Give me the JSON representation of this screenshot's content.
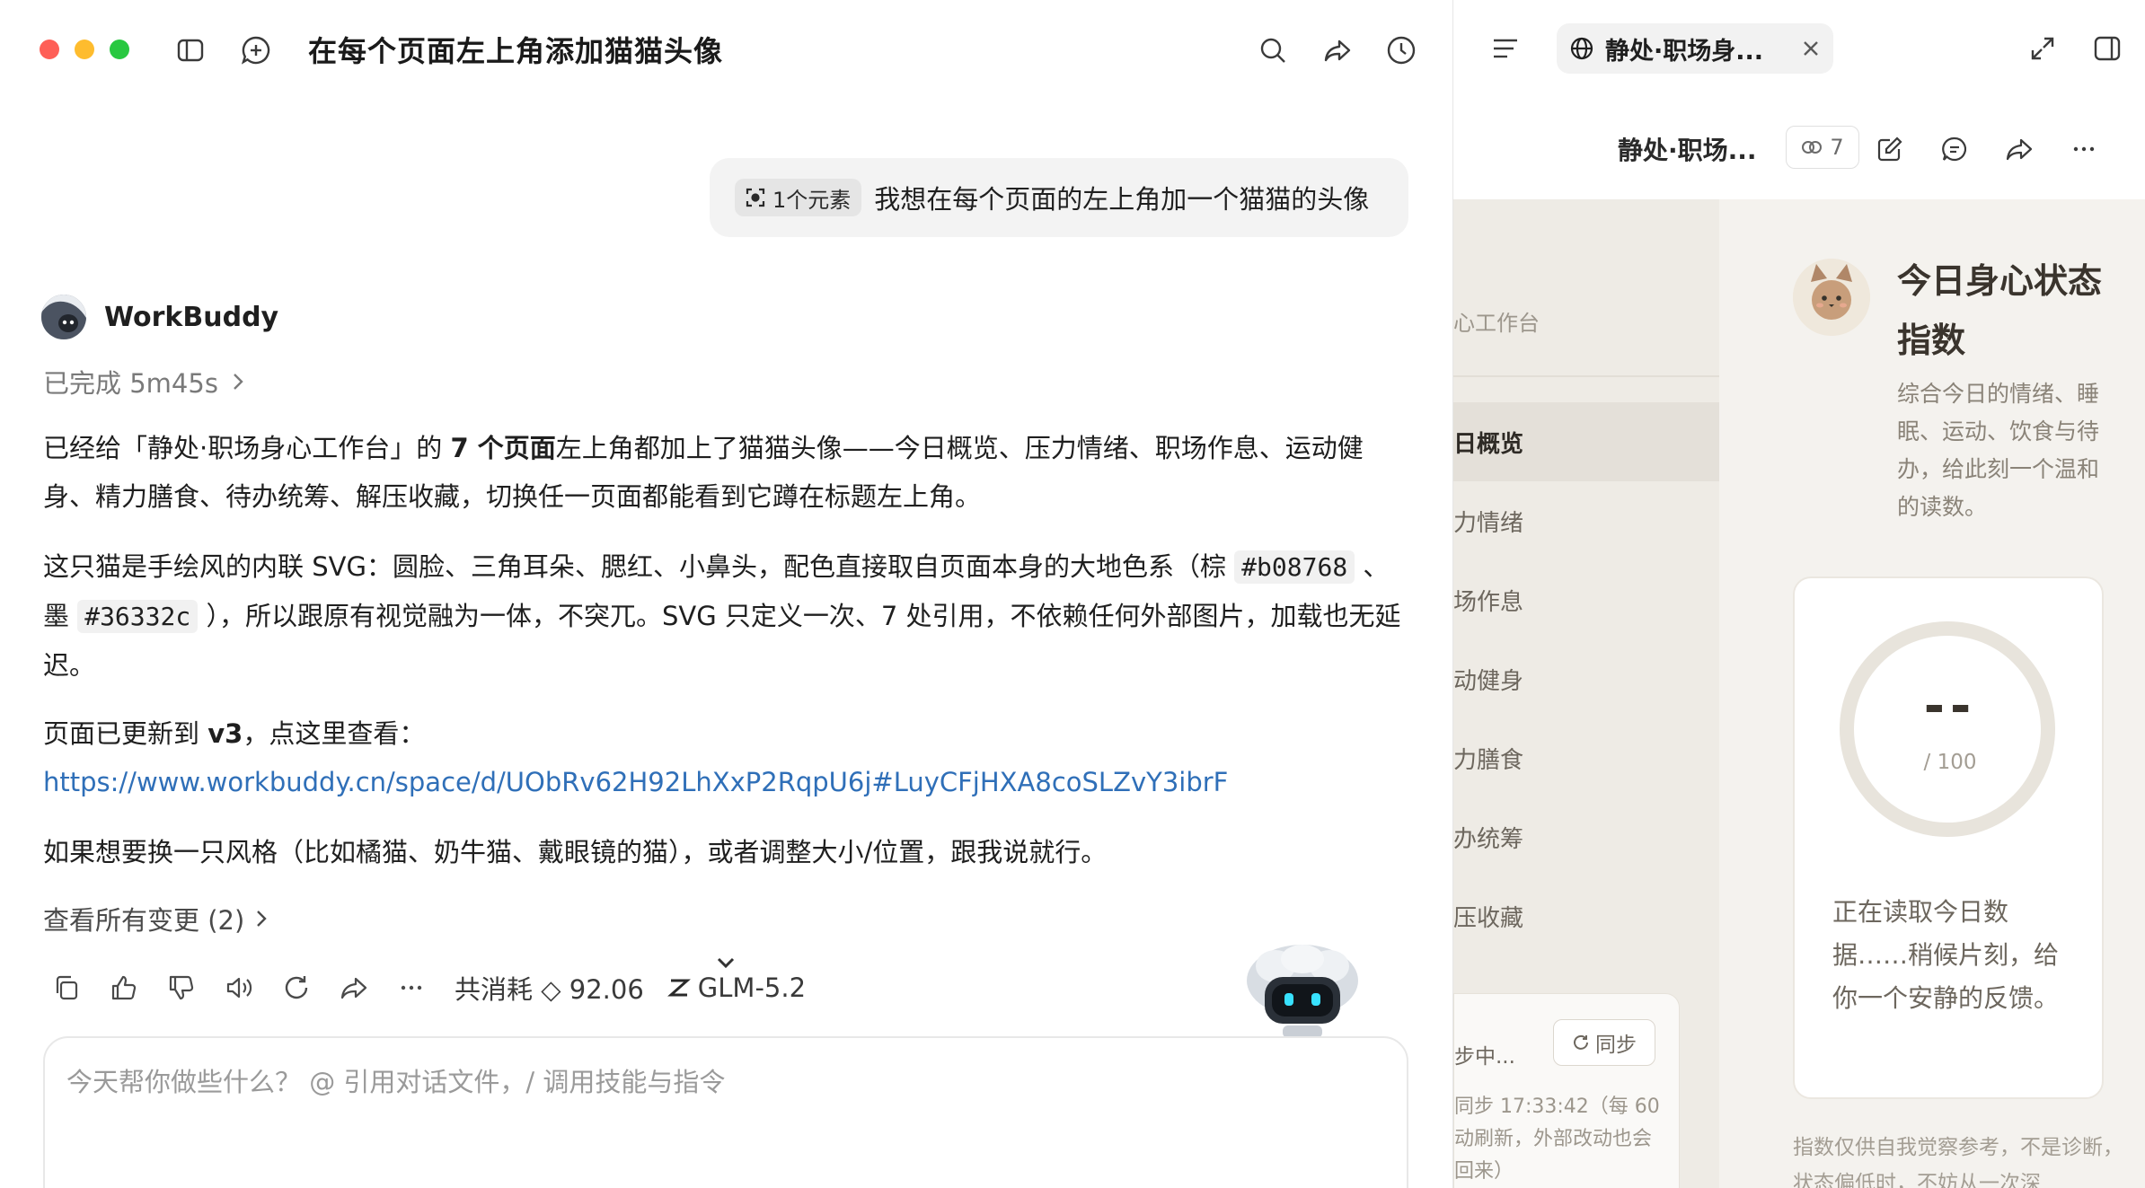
{
  "window": {
    "traffic_lights": {
      "close": "#fe5f57",
      "minimize": "#febc2e",
      "maximize": "#28c840"
    }
  },
  "chat": {
    "title": "在每个页面左上角添加猫猫头像",
    "user_message": {
      "chip_label": "1个元素",
      "text": "我想在每个页面的左上角加一个猫猫的头像"
    },
    "agent": {
      "name": "WorkBuddy",
      "status": "已完成 5m45s"
    },
    "response": {
      "p1_a": "已经给「静处·职场身心工作台」的 ",
      "p1_b": "7 个页面",
      "p1_c": "左上角都加上了猫猫头像——今日概览、压力情绪、职场作息、运动健身、精力膳食、待办统筹、解压收藏，切换任一页面都能看到它蹲在标题左上角。",
      "p2_a": "这只猫是手绘风的内联 SVG：圆脸、三角耳朵、腮红、小鼻头，配色直接取自页面本身的大地色系（棕 ",
      "p2_code1": "#b08768",
      "p2_b": " 、墨 ",
      "p2_code2": "#36332c",
      "p2_c": " ），所以跟原有视觉融为一体，不突兀。SVG 只定义一次、7 处引用，不依赖任何外部图片，加载也无延迟。",
      "p3_a": "页面已更新到 ",
      "p3_b": "v3",
      "p3_c": "，点这里查看：",
      "link": "https://www.workbuddy.cn/space/d/UObRv62H92LhXxP2RqpU6j#LuyCFjHXA8coSLZvY3ibrF",
      "p4": "如果想要换一只风格（比如橘猫、奶牛猫、戴眼镜的猫），或者调整大小/位置，跟我说就行。"
    },
    "changes_label": "查看所有变更 (2)",
    "usage_label": "共消耗",
    "usage_value": "92.06",
    "model": "GLM-5.2",
    "composer_placeholder": "今天帮你做些什么？ @ 引用对话文件，/ 调用技能与指令",
    "icons": [
      "sidebar-toggle-icon",
      "new-chat-icon",
      "search-icon",
      "share-icon",
      "history-icon",
      "copy-icon",
      "thumbs-up-icon",
      "thumbs-down-icon",
      "speaker-icon",
      "regenerate-icon",
      "share-icon",
      "more-icon"
    ]
  },
  "preview": {
    "tab_title": "静处·职场身...",
    "doc_title": "静处·职场...",
    "collab_count": "7",
    "nav": {
      "header": "心工作台",
      "items": [
        "日概览",
        "力情绪",
        "场作息",
        "动健身",
        "力膳食",
        "办统筹",
        "压收藏"
      ],
      "active_index": 0
    },
    "sync": {
      "status": "步中...",
      "button": "同步",
      "time_text": "同步 17:33:42（每 60 动刷新，外部改动也会 回来）"
    },
    "mood": {
      "title": "今日身心状态指数",
      "description": "综合今日的情绪、睡眠、运动、饮食与待办，给此刻一个温和的读数。",
      "score": "--",
      "score_max": "/ 100",
      "loading": "正在读取今日数据……稍候片刻，给你一个安静的反馈。"
    },
    "disclaimer": "指数仅供自我觉察参考，不是诊断，状态偏低时，不妨从一次深",
    "colors": {
      "brown": "#b08768",
      "ink": "#36332c",
      "bg": "#f4f2ee"
    }
  }
}
